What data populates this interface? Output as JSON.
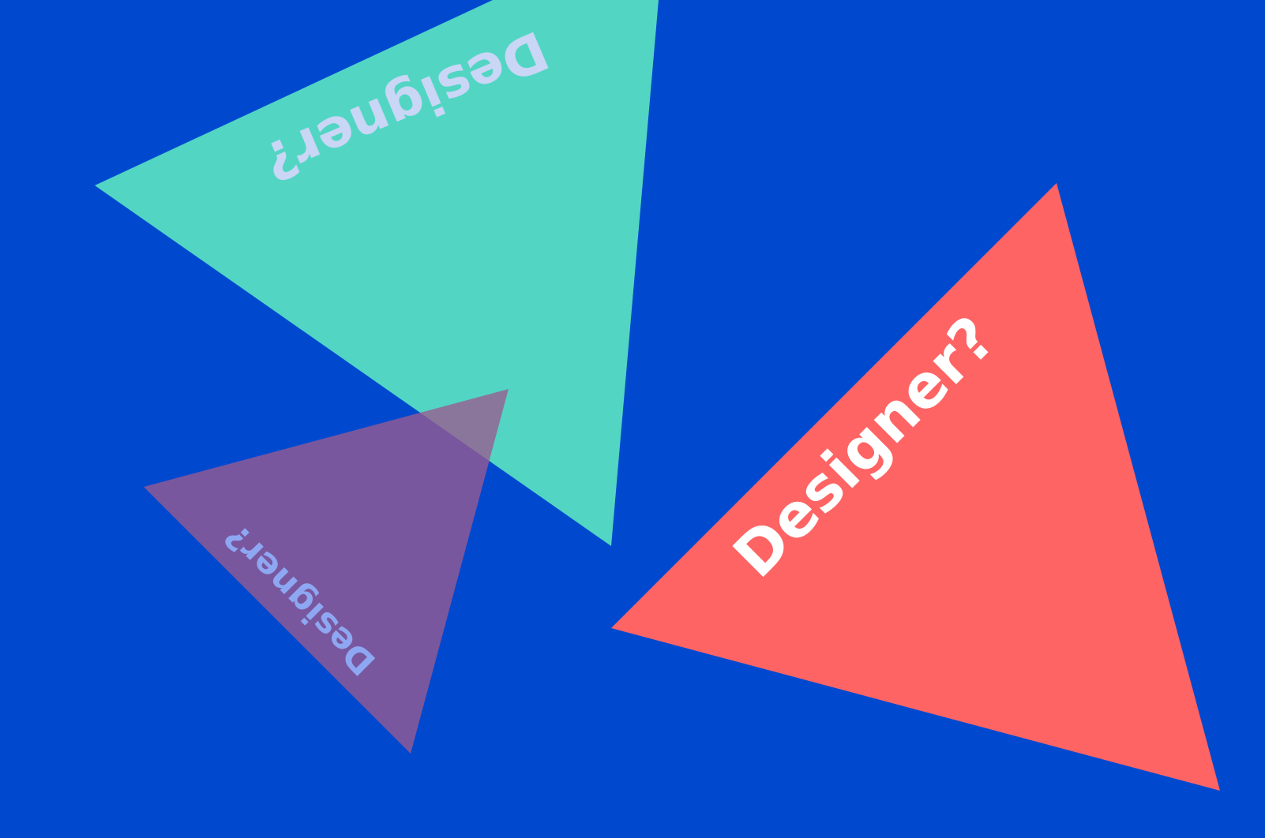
{
  "colors": {
    "background": "#0049cf",
    "teal_triangle": "#52d6c3",
    "coral_triangle": "#fe6464",
    "purple_triangle": "#9b5b8f",
    "teal_text": "#c9d6f5",
    "coral_text": "#ffffff",
    "purple_text": "#8ea7f2"
  },
  "labels": {
    "teal": "Designer?",
    "coral": "Designer?",
    "purple": "Designer?"
  }
}
